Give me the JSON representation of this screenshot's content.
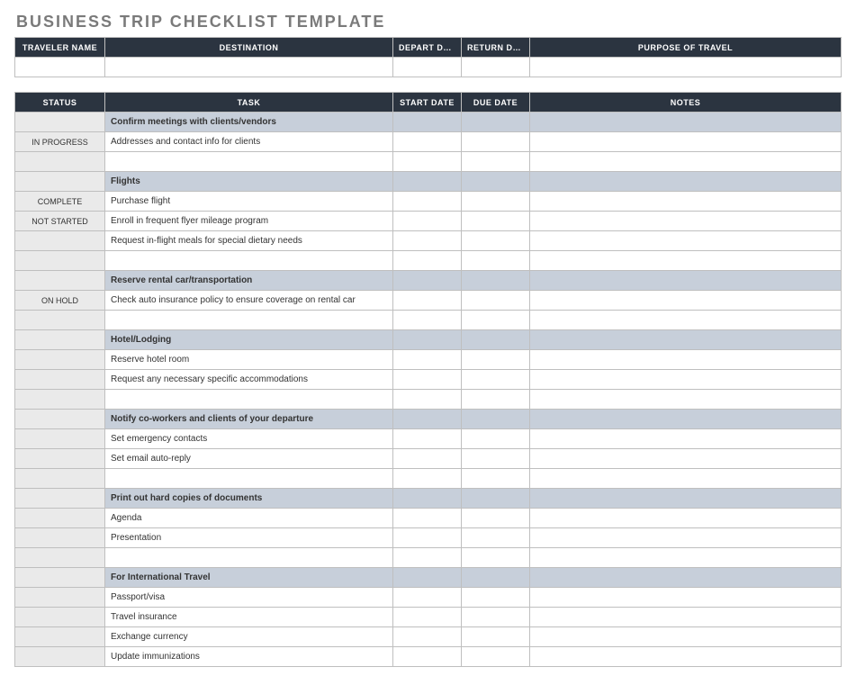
{
  "title": "BUSINESS TRIP CHECKLIST TEMPLATE",
  "info": {
    "headers": [
      "TRAVELER NAME",
      "DESTINATION",
      "DEPART DATE",
      "RETURN DATE",
      "PURPOSE OF TRAVEL"
    ],
    "values": [
      "",
      "",
      "",
      "",
      ""
    ]
  },
  "checklist": {
    "headers": [
      "STATUS",
      "TASK",
      "START DATE",
      "DUE DATE",
      "NOTES"
    ],
    "rows": [
      {
        "type": "section",
        "task": "Confirm meetings with clients/vendors"
      },
      {
        "type": "task",
        "status": "IN PROGRESS",
        "task": "Addresses and contact info for clients",
        "start": "",
        "due": "",
        "notes": ""
      },
      {
        "type": "spacer"
      },
      {
        "type": "section",
        "task": "Flights"
      },
      {
        "type": "task",
        "status": "COMPLETE",
        "task": "Purchase flight",
        "start": "",
        "due": "",
        "notes": ""
      },
      {
        "type": "task",
        "status": "NOT STARTED",
        "task": "Enroll in frequent flyer mileage program",
        "start": "",
        "due": "",
        "notes": ""
      },
      {
        "type": "task",
        "status": "",
        "task": "Request in-flight meals for special dietary needs",
        "start": "",
        "due": "",
        "notes": ""
      },
      {
        "type": "spacer"
      },
      {
        "type": "section",
        "task": "Reserve rental car/transportation"
      },
      {
        "type": "task",
        "status": "ON HOLD",
        "task": "Check auto insurance policy to ensure coverage on rental car",
        "start": "",
        "due": "",
        "notes": ""
      },
      {
        "type": "spacer"
      },
      {
        "type": "section",
        "task": "Hotel/Lodging"
      },
      {
        "type": "task",
        "status": "",
        "task": "Reserve hotel room",
        "start": "",
        "due": "",
        "notes": ""
      },
      {
        "type": "task",
        "status": "",
        "task": "Request any necessary specific accommodations",
        "start": "",
        "due": "",
        "notes": ""
      },
      {
        "type": "spacer"
      },
      {
        "type": "section",
        "task": "Notify co-workers and clients of your departure"
      },
      {
        "type": "task",
        "status": "",
        "task": "Set emergency contacts",
        "start": "",
        "due": "",
        "notes": ""
      },
      {
        "type": "task",
        "status": "",
        "task": "Set email auto-reply",
        "start": "",
        "due": "",
        "notes": ""
      },
      {
        "type": "spacer"
      },
      {
        "type": "section",
        "task": "Print out hard copies of documents"
      },
      {
        "type": "task",
        "status": "",
        "task": "Agenda",
        "start": "",
        "due": "",
        "notes": ""
      },
      {
        "type": "task",
        "status": "",
        "task": "Presentation",
        "start": "",
        "due": "",
        "notes": ""
      },
      {
        "type": "spacer"
      },
      {
        "type": "section",
        "task": "For International Travel"
      },
      {
        "type": "task",
        "status": "",
        "task": "Passport/visa",
        "start": "",
        "due": "",
        "notes": ""
      },
      {
        "type": "task",
        "status": "",
        "task": "Travel insurance",
        "start": "",
        "due": "",
        "notes": ""
      },
      {
        "type": "task",
        "status": "",
        "task": "Exchange currency",
        "start": "",
        "due": "",
        "notes": ""
      },
      {
        "type": "task",
        "status": "",
        "task": "Update immunizations",
        "start": "",
        "due": "",
        "notes": ""
      }
    ]
  }
}
